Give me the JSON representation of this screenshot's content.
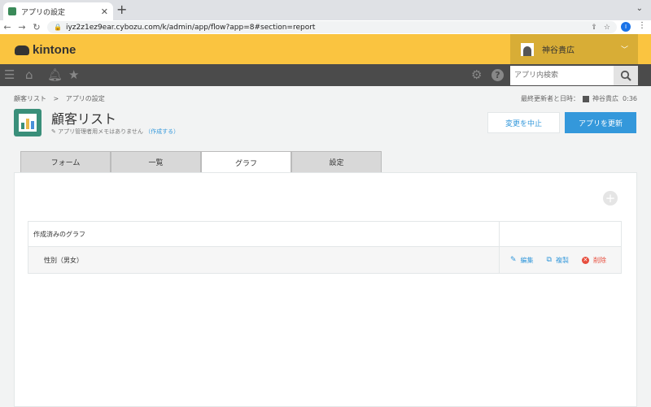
{
  "browser": {
    "tab_title": "アプリの設定",
    "new_tab": "+",
    "tab_close": "✕",
    "menu": "⌄",
    "url": "iyz2z1ez9ear.cybozu.com/k/admin/app/flow?app=8#section=report",
    "profile_initial": "I"
  },
  "header": {
    "logo": "kintone",
    "user_name": "神谷貴広"
  },
  "nav": {
    "search_placeholder": "アプリ内検索"
  },
  "page": {
    "breadcrumb": [
      "顧客リスト",
      "アプリの設定"
    ],
    "breadcrumb_sep": ">",
    "last_updated_label": "最終更新者と日時：",
    "last_updated_user": "神谷貴広",
    "last_updated_time": "0:36",
    "app_title": "顧客リスト",
    "memo_text": "アプリ管理者用メモはありません",
    "memo_link": "（作成する）",
    "cancel_label": "変更を中止",
    "save_label": "アプリを更新"
  },
  "tabs": [
    {
      "label": "フォーム",
      "active": false
    },
    {
      "label": "一覧",
      "active": false
    },
    {
      "label": "グラフ",
      "active": true
    },
    {
      "label": "設定",
      "active": false
    }
  ],
  "graphs": {
    "header": "作成済みのグラフ",
    "rows": [
      {
        "name": "性別（男女）"
      }
    ],
    "edit_label": "編集",
    "copy_label": "複製",
    "delete_label": "削除"
  },
  "colors": {
    "header_yellow": "#fac440",
    "nav_dark": "#4b4b4b",
    "accent_blue": "#3498db",
    "delete_red": "#e74c3c"
  }
}
